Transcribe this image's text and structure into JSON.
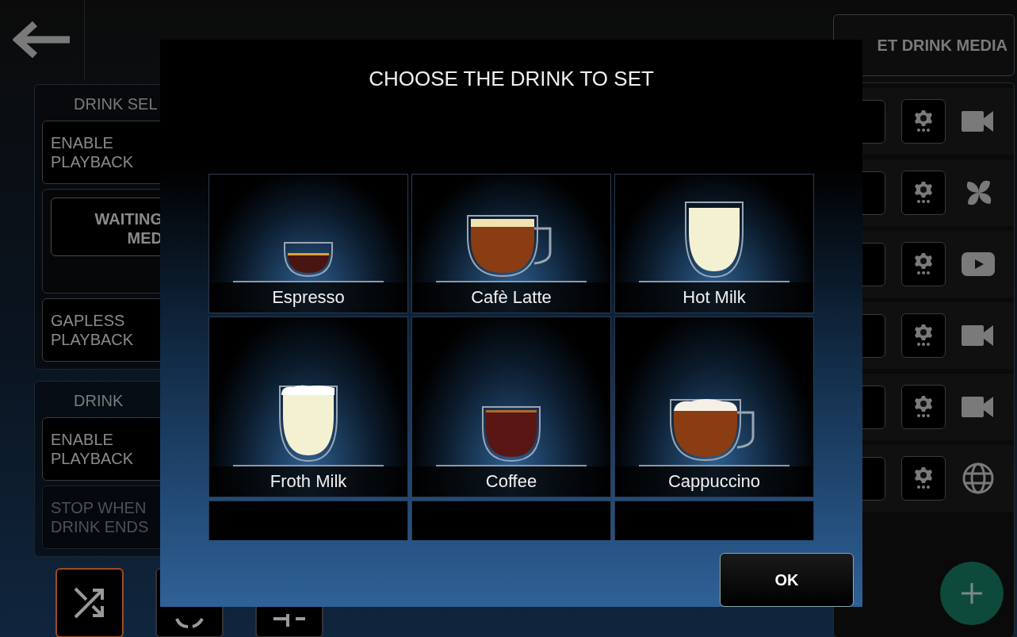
{
  "left_panels": [
    {
      "title": "DRINK SEL",
      "items": [
        {
          "kind": "toggle",
          "label": "ENABLE PLAYBACK",
          "disabled": false
        },
        {
          "kind": "media",
          "label": "WAITING MED",
          "disabled": false
        },
        {
          "kind": "toggle",
          "label": "GAPLESS PLAYBACK",
          "disabled": false
        }
      ]
    },
    {
      "title": "DRINK",
      "items": [
        {
          "kind": "toggle",
          "label": "ENABLE PLAYBACK",
          "disabled": false
        },
        {
          "kind": "toggle",
          "label": "STOP WHEN DRINK ENDS",
          "disabled": true
        }
      ]
    }
  ],
  "toolbar": [
    {
      "kind": "shuffle",
      "selected": true
    },
    {
      "kind": "repeat",
      "selected": false
    },
    {
      "kind": "split",
      "selected": false
    }
  ],
  "right_panel": {
    "button": "ET DRINK MEDIA",
    "rows": [
      {
        "kind": "video"
      },
      {
        "kind": "pinwheel"
      },
      {
        "kind": "youtube"
      },
      {
        "kind": "video"
      },
      {
        "kind": "video"
      },
      {
        "kind": "globe"
      }
    ]
  },
  "dialog": {
    "title": "CHOOSE THE DRINK TO SET",
    "drinks": [
      {
        "kind": "espresso",
        "name": "Espresso"
      },
      {
        "kind": "latte",
        "name": "Cafè Latte"
      },
      {
        "kind": "milk",
        "name": "Hot Milk"
      },
      {
        "kind": "froth",
        "name": "Froth Milk"
      },
      {
        "kind": "coffee",
        "name": "Coffee"
      },
      {
        "kind": "cappuccino",
        "name": "Cappuccino"
      },
      {
        "kind": "empty"
      },
      {
        "kind": "empty"
      },
      {
        "kind": "empty"
      }
    ],
    "button": "OK"
  }
}
